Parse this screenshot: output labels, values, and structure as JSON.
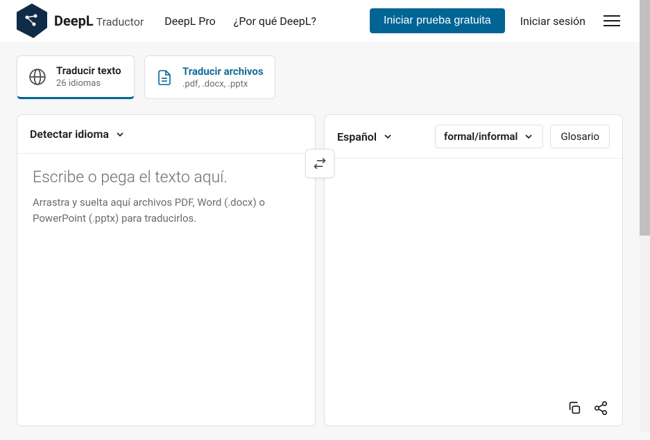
{
  "brand": {
    "name": "DeepL",
    "suffix": "Traductor"
  },
  "nav": {
    "pro": "DeepL Pro",
    "why": "¿Por qué DeepL?"
  },
  "header": {
    "cta": "Iniciar prueba gratuita",
    "login": "Iniciar sesión"
  },
  "tabs": {
    "text": {
      "title": "Traducir texto",
      "sub": "26 idiomas"
    },
    "files": {
      "title": "Traducir archivos",
      "sub": ".pdf, .docx, .pptx"
    }
  },
  "source": {
    "lang": "Detectar idioma",
    "placeholder": "Escribe o pega el texto aquí.",
    "hint": "Arrastra y suelta aquí archivos PDF, Word (.docx) o PowerPoint (.pptx) para traducirlos."
  },
  "target": {
    "lang": "Español",
    "formality": "formal/informal",
    "glossary": "Glosario"
  }
}
